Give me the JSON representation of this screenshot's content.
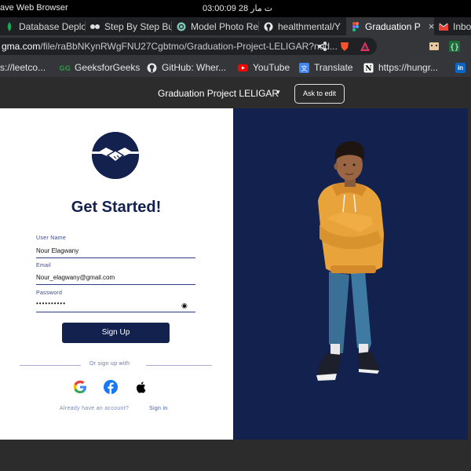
{
  "os": {
    "app_title": "ave Web Browser",
    "clock": "03:00:09  28 ت مار"
  },
  "tabs": [
    {
      "label": "Database Deplo",
      "icon": "mongodb-leaf-icon"
    },
    {
      "label": "Step By Step Bu",
      "icon": "dots-icon"
    },
    {
      "label": "Model Photo Re",
      "icon": "openai-icon"
    },
    {
      "label": "healthmental/Y",
      "icon": "github-icon"
    },
    {
      "label": "Graduation P",
      "icon": "figma-icon",
      "active": true,
      "close": "×"
    },
    {
      "label": "Inbo",
      "icon": "gmail-icon"
    }
  ],
  "address": {
    "host": "gma.com",
    "path": "/file/raBbNKynRWgFNU27Cgbtmo/Graduation-Project-LELIGAR?nod..."
  },
  "bookmarks": [
    {
      "label": "s://leetco...",
      "icon": "link-icon"
    },
    {
      "label": "GeeksforGeeks",
      "icon": "geeksforgeeks-icon"
    },
    {
      "label": "GitHub: Wher...",
      "icon": "github-icon"
    },
    {
      "label": "YouTube",
      "icon": "youtube-icon"
    },
    {
      "label": "Translate",
      "icon": "translate-icon"
    },
    {
      "label": "https://hungr...",
      "icon": "notion-icon"
    },
    {
      "label": "in",
      "icon": "linkedin-icon"
    }
  ],
  "figma": {
    "project_title": "Graduation Project LELIGAR",
    "ask_button": "Ask to edit"
  },
  "form": {
    "heading": "Get Started!",
    "username_label": "User Name",
    "username_value": "Nour Elagwany",
    "email_label": "Email",
    "email_value": "Nour_elagwany@gmail.com",
    "password_label": "Password",
    "password_value": "••••••••••",
    "submit": "Sign Up",
    "or_text": "Or sign up with",
    "have_account": "Already have an account?",
    "sign_in": "Sign in"
  },
  "colors": {
    "navy": "#13214f",
    "figma_dark": "#2c2c2c",
    "accent_blue": "#3d58c2"
  }
}
